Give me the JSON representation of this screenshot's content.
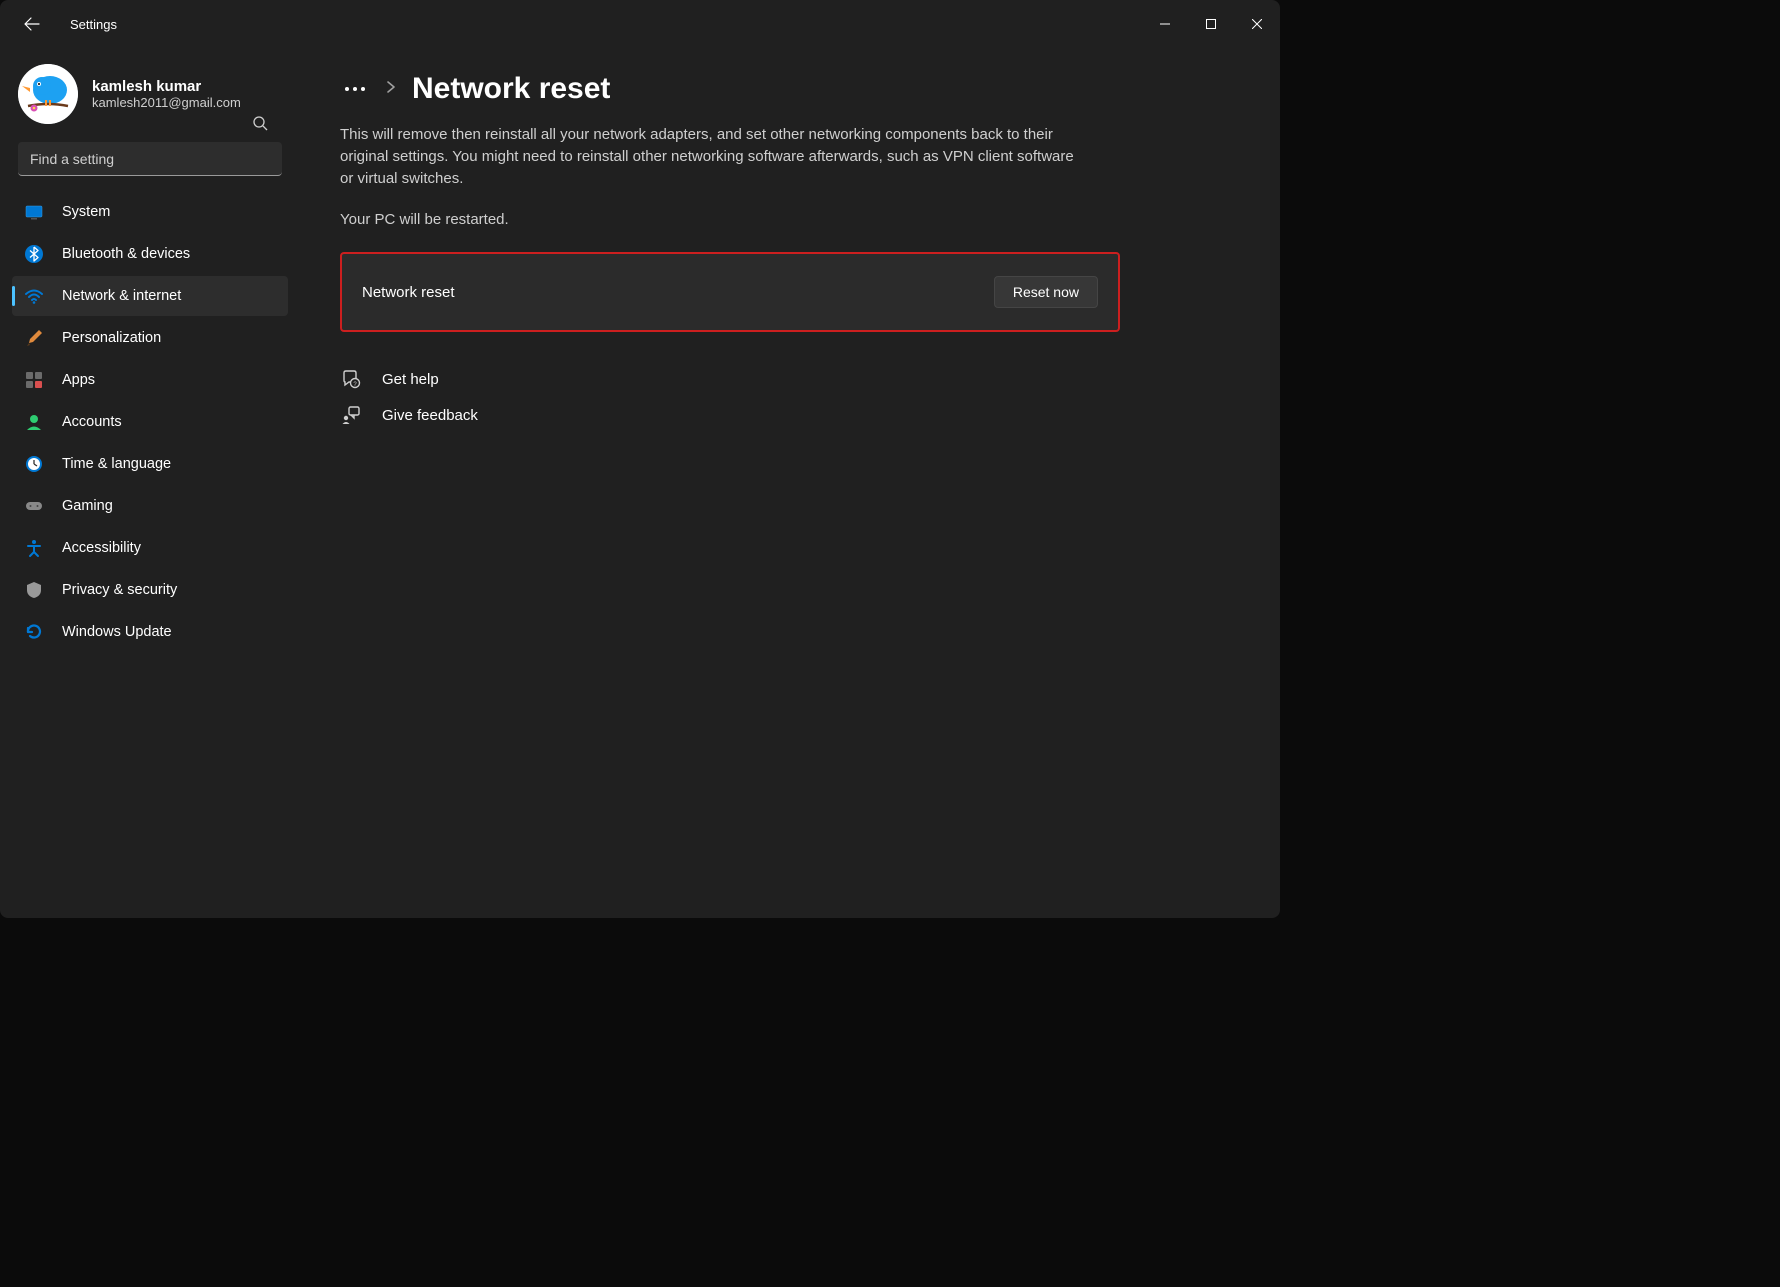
{
  "window": {
    "title": "Settings"
  },
  "user": {
    "name": "kamlesh kumar",
    "email": "kamlesh2011@gmail.com"
  },
  "search": {
    "placeholder": "Find a setting"
  },
  "sidebar": {
    "items": [
      {
        "label": "System"
      },
      {
        "label": "Bluetooth & devices"
      },
      {
        "label": "Network & internet"
      },
      {
        "label": "Personalization"
      },
      {
        "label": "Apps"
      },
      {
        "label": "Accounts"
      },
      {
        "label": "Time & language"
      },
      {
        "label": "Gaming"
      },
      {
        "label": "Accessibility"
      },
      {
        "label": "Privacy & security"
      },
      {
        "label": "Windows Update"
      }
    ],
    "active_index": 2
  },
  "main": {
    "page_title": "Network reset",
    "description": "This will remove then reinstall all your network adapters, and set other networking components back to their original settings. You might need to reinstall other networking software afterwards, such as VPN client software or virtual switches.",
    "sub_description": "Your PC will be restarted.",
    "card": {
      "label": "Network reset",
      "button": "Reset now"
    },
    "help": {
      "get_help": "Get help",
      "give_feedback": "Give feedback"
    }
  }
}
